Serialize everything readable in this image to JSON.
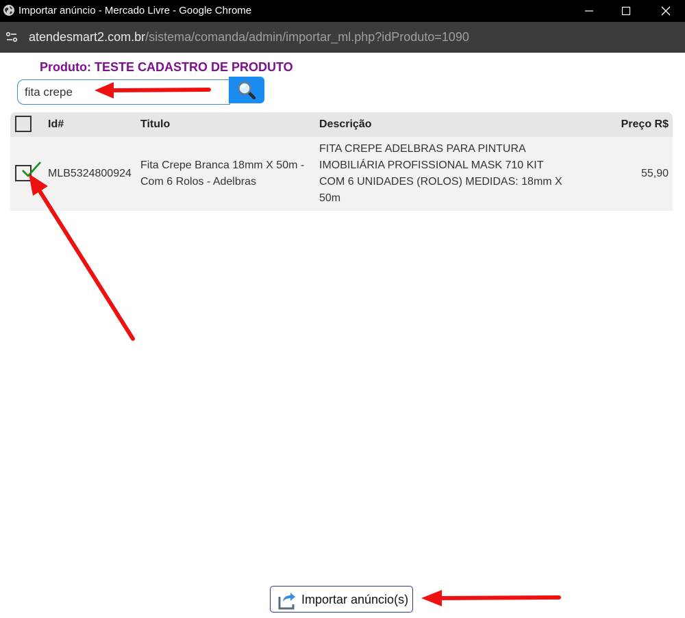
{
  "window": {
    "title": "Importar anúncio - Mercado Livre - Google Chrome"
  },
  "address_bar": {
    "host": "atendesmart2.com.br",
    "path": "/sistema/comanda/admin/importar_ml.php?idProduto=1090"
  },
  "page": {
    "product_title": "Produto: TESTE CADASTRO DE PRODUTO",
    "search": {
      "value": "fita crepe"
    },
    "table": {
      "headers": {
        "id": "Id#",
        "title": "Titulo",
        "description": "Descrição",
        "price": "Preço R$"
      },
      "rows": [
        {
          "checked": true,
          "id": "MLB5324800924",
          "title_line1": "Fita Crepe Branca 18mm X 50m -",
          "title_line2": "Com 6 Rolos - Adelbras",
          "desc_line1": "FITA CREPE ADELBRAS PARA PINTURA",
          "desc_line2": "IMOBILIÁRIA PROFISSIONAL MASK 710 KIT",
          "desc_line3": "COM 6 UNIDADES (ROLOS) MEDIDAS: 18mm X",
          "desc_line4": "50m",
          "price": "55,90"
        }
      ]
    },
    "import_button": {
      "label": "Importar anúncio(s)"
    }
  },
  "colors": {
    "product_title": "#7d0f8f",
    "search_button": "#1a8cf0",
    "annotation_arrows": "#ee1111",
    "checkmark": "#1f8f1f"
  }
}
